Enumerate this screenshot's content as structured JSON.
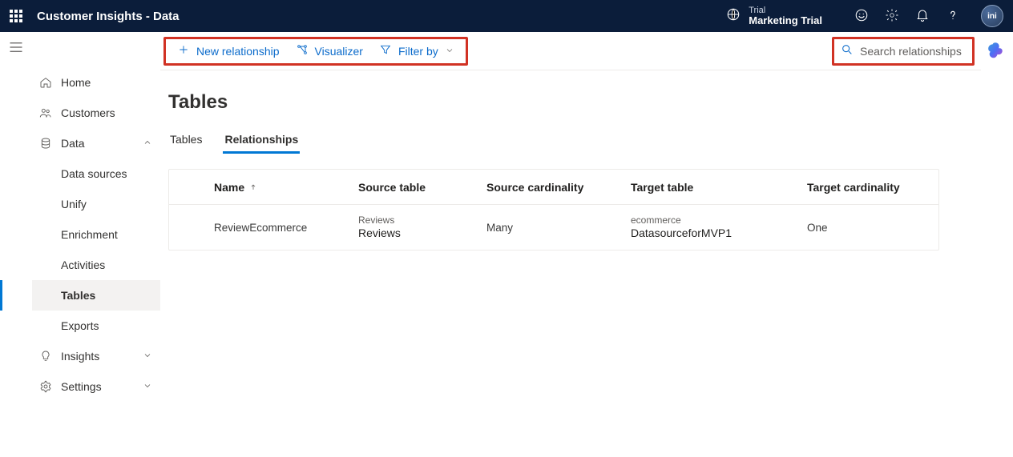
{
  "header": {
    "appTitle": "Customer Insights - Data",
    "trialLabel": "Trial",
    "trialName": "Marketing Trial",
    "avatarInitials": "ini"
  },
  "sidebar": {
    "home": "Home",
    "customers": "Customers",
    "data": "Data",
    "dataChildren": {
      "dataSources": "Data sources",
      "unify": "Unify",
      "enrichment": "Enrichment",
      "activities": "Activities",
      "tables": "Tables",
      "exports": "Exports"
    },
    "insights": "Insights",
    "settings": "Settings"
  },
  "toolbar": {
    "newRelationship": "New relationship",
    "visualizer": "Visualizer",
    "filterBy": "Filter by",
    "searchPlaceholder": "Search relationships"
  },
  "page": {
    "title": "Tables",
    "tabs": {
      "tables": "Tables",
      "relationships": "Relationships"
    }
  },
  "table": {
    "columns": {
      "name": "Name",
      "sourceTable": "Source table",
      "sourceCardinality": "Source cardinality",
      "targetTable": "Target table",
      "targetCardinality": "Target cardinality"
    },
    "rows": [
      {
        "name": "ReviewEcommerce",
        "sourceSmall": "Reviews",
        "sourceBig": "Reviews",
        "sourceCardinality": "Many",
        "targetSmall": "ecommerce",
        "targetBig": "DatasourceforMVP1",
        "targetCardinality": "One"
      }
    ]
  }
}
